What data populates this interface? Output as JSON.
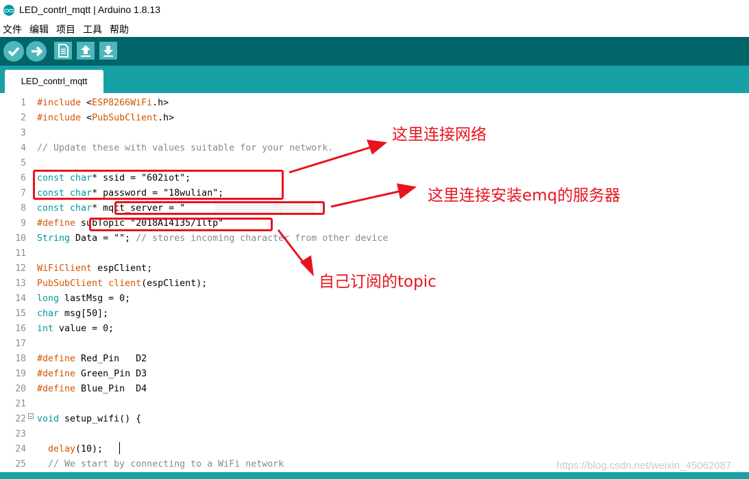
{
  "window": {
    "title": "LED_contrl_mqtt | Arduino 1.8.13"
  },
  "menu": [
    "文件",
    "编辑",
    "项目",
    "工具",
    "帮助"
  ],
  "toolbar": {
    "buttons": [
      "verify-icon",
      "upload-icon",
      "new-icon",
      "open-icon",
      "save-icon"
    ]
  },
  "tab": {
    "label": "LED_contrl_mqtt"
  },
  "code": {
    "lines": [
      {
        "n": "1",
        "t": "#include <ESP8266WiFi.h>"
      },
      {
        "n": "2",
        "t": "#include <PubSubClient.h>"
      },
      {
        "n": "3",
        "t": ""
      },
      {
        "n": "4",
        "t": "// Update these with values suitable for your network."
      },
      {
        "n": "5",
        "t": ""
      },
      {
        "n": "6",
        "t": "const char* ssid = \"602iot\";"
      },
      {
        "n": "7",
        "t": "const char* password = \"18wulian\";"
      },
      {
        "n": "8",
        "t": "const char* mqtt_server = \"                \";"
      },
      {
        "n": "9",
        "t": "#define subTopic \"2018A14135/1ltp\""
      },
      {
        "n": "10",
        "t": "String Data = \"\"; // stores incoming character from other device"
      },
      {
        "n": "11",
        "t": ""
      },
      {
        "n": "12",
        "t": "WiFiClient espClient;"
      },
      {
        "n": "13",
        "t": "PubSubClient client(espClient);"
      },
      {
        "n": "14",
        "t": "long lastMsg = 0;"
      },
      {
        "n": "15",
        "t": "char msg[50];"
      },
      {
        "n": "16",
        "t": "int value = 0;"
      },
      {
        "n": "17",
        "t": ""
      },
      {
        "n": "18",
        "t": "#define Red_Pin   D2"
      },
      {
        "n": "19",
        "t": "#define Green_Pin D3"
      },
      {
        "n": "20",
        "t": "#define Blue_Pin  D4"
      },
      {
        "n": "21",
        "t": ""
      },
      {
        "n": "22",
        "t": "void setup_wifi() {"
      },
      {
        "n": "23",
        "t": ""
      },
      {
        "n": "24",
        "t": "  delay(10);"
      },
      {
        "n": "25",
        "t": "  // We start by connecting to a WiFi network"
      }
    ]
  },
  "annotations": {
    "network": "这里连接网络",
    "server": "这里连接安装emq的服务器",
    "topic": "自己订阅的topic"
  },
  "watermark": "https://blog.csdn.net/weixin_45062087",
  "colors": {
    "toolbar": "#006468",
    "tabbar": "#17a1a5",
    "button": "#4db7bb",
    "keyword": "#00979c",
    "type": "#d35400",
    "annotation": "#e8131f"
  }
}
